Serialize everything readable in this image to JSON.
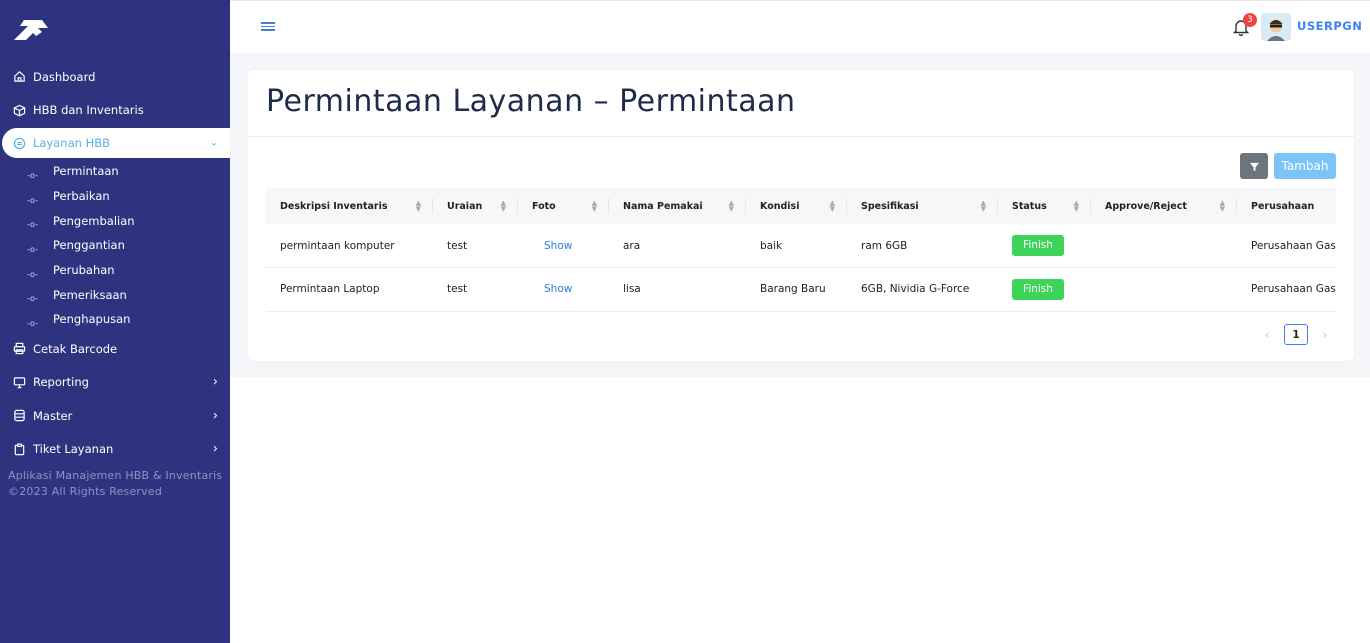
{
  "sidebar": {
    "items": [
      {
        "label": "Dashboard",
        "icon": "home-icon"
      },
      {
        "label": "HBB dan Inventaris",
        "icon": "box-icon"
      },
      {
        "label": "Layanan HBB",
        "icon": "service-icon",
        "active": true
      }
    ],
    "subitems": [
      "Permintaan",
      "Perbaikan",
      "Pengembalian",
      "Penggantian",
      "Perubahan",
      "Pemeriksaan",
      "Penghapusan"
    ],
    "items_after": [
      {
        "label": "Cetak Barcode",
        "icon": "printer-icon"
      },
      {
        "label": "Reporting",
        "icon": "monitor-icon"
      },
      {
        "label": "Master",
        "icon": "database-icon"
      },
      {
        "label": "Tiket Layanan",
        "icon": "clipboard-icon"
      }
    ],
    "footer_line1": "Aplikasi Manajemen HBB & Inventaris",
    "footer_line2": "©2023 All Rights Reserved"
  },
  "topbar": {
    "notification_count": "3",
    "username": "USERPGN"
  },
  "page": {
    "title": "Permintaan Layanan – Permintaan",
    "add_button": "Tambah"
  },
  "table": {
    "headers": [
      "Deskripsi Inventaris",
      "Uraian",
      "Foto",
      "Nama Pemakai",
      "Kondisi",
      "Spesifikasi",
      "Status",
      "Approve/Reject",
      "Perusahaan"
    ],
    "rows": [
      {
        "deskripsi": "permintaan komputer",
        "uraian": "test",
        "foto": "Show",
        "nama": "ara",
        "kondisi": "baik",
        "spesifikasi": "ram 6GB",
        "status": "Finish",
        "approve": "",
        "perusahaan": "Perusahaan Gas Negara"
      },
      {
        "deskripsi": "Permintaan Laptop",
        "uraian": "test",
        "foto": "Show",
        "nama": "lisa",
        "kondisi": "Barang Baru",
        "spesifikasi": "6GB, Nividia G-Force",
        "status": "Finish",
        "approve": "",
        "perusahaan": "Perusahaan Gas Negara"
      }
    ]
  },
  "pagination": {
    "current": "1"
  },
  "colors": {
    "sidebar": "#2e3380",
    "accent": "#3b82f6",
    "status_finish": "#3ed45a"
  }
}
